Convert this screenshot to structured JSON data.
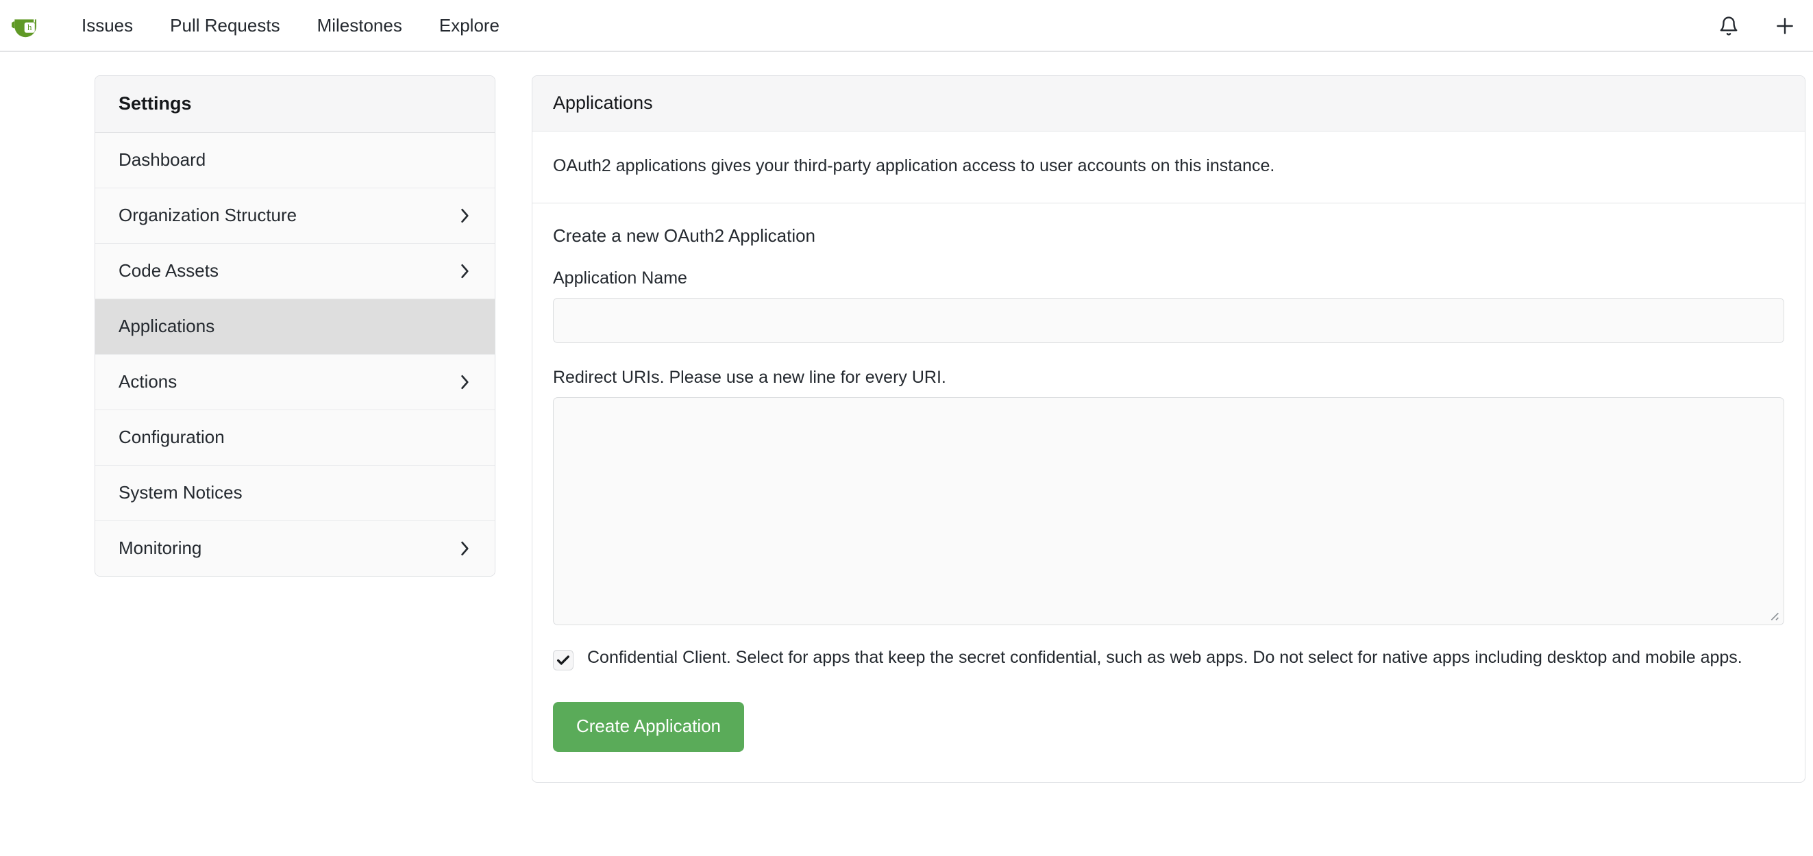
{
  "navbar": {
    "logo_icon": "gitea-teacup-logo-icon",
    "links": [
      {
        "label": "Issues"
      },
      {
        "label": "Pull Requests"
      },
      {
        "label": "Milestones"
      },
      {
        "label": "Explore"
      }
    ],
    "right_icons": [
      {
        "name": "bell-icon"
      },
      {
        "name": "plus-icon"
      }
    ]
  },
  "sidebar": {
    "title": "Settings",
    "items": [
      {
        "label": "Dashboard",
        "chevron": false,
        "active": false
      },
      {
        "label": "Organization Structure",
        "chevron": true,
        "active": false
      },
      {
        "label": "Code Assets",
        "chevron": true,
        "active": false
      },
      {
        "label": "Applications",
        "chevron": false,
        "active": true
      },
      {
        "label": "Actions",
        "chevron": true,
        "active": false
      },
      {
        "label": "Configuration",
        "chevron": false,
        "active": false
      },
      {
        "label": "System Notices",
        "chevron": false,
        "active": false
      },
      {
        "label": "Monitoring",
        "chevron": true,
        "active": false
      }
    ]
  },
  "main": {
    "header": "Applications",
    "description": "OAuth2 applications gives your third-party application access to user accounts on this instance.",
    "form": {
      "title": "Create a new OAuth2 Application",
      "app_name_label": "Application Name",
      "app_name_value": "",
      "app_name_placeholder": "",
      "redirect_label": "Redirect URIs. Please use a new line for every URI.",
      "redirect_value": "",
      "redirect_placeholder": "",
      "confidential_label": "Confidential Client. Select for apps that keep the secret confidential, such as web apps. Do not select for native apps including desktop and mobile apps.",
      "confidential_checked": true,
      "submit_label": "Create Application"
    }
  },
  "colors": {
    "accent_green": "#5aab59",
    "panel_header_bg": "#f6f6f7",
    "active_item_bg": "#dedede",
    "border": "#dfe1e4"
  }
}
